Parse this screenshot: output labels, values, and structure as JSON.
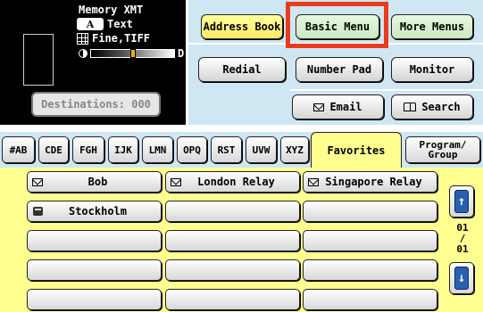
{
  "status": {
    "mode_title": "Memory XMT",
    "mode_icon_letter": "A",
    "doc_type": "Text",
    "resolution": "Fine,TIFF",
    "contrast_level": 0.5,
    "contrast_end_label": "D",
    "destinations_label": "Destinations: 000"
  },
  "top_menu": {
    "address_book": "Address Book",
    "basic_menu": "Basic Menu",
    "more_menus": "More Menus",
    "redial": "Redial",
    "number_pad": "Number Pad",
    "monitor": "Monitor",
    "email": "Email",
    "search": "Search"
  },
  "tabs": [
    {
      "label": "#AB"
    },
    {
      "label": "CDE"
    },
    {
      "label": "FGH"
    },
    {
      "label": "IJK"
    },
    {
      "label": "LMN"
    },
    {
      "label": "OPQ"
    },
    {
      "label": "RST"
    },
    {
      "label": "UVW"
    },
    {
      "label": "XYZ"
    },
    {
      "label": "Favorites"
    },
    {
      "label_line1": "Program/",
      "label_line2": "Group"
    }
  ],
  "favorites": [
    {
      "name": "Bob",
      "icon": "email-icon"
    },
    {
      "name": "London Relay",
      "icon": "email-icon"
    },
    {
      "name": "Singapore Relay",
      "icon": "email-icon"
    },
    {
      "name": "Stockholm",
      "icon": "fax-icon"
    }
  ],
  "pagination": {
    "current": "01",
    "sep": "/",
    "total": "01"
  },
  "colors": {
    "panel_bg": "#cfe6f3",
    "favorites_bg": "#ffff90",
    "highlight": "#ea3c1c",
    "status_bg": "#000000"
  }
}
